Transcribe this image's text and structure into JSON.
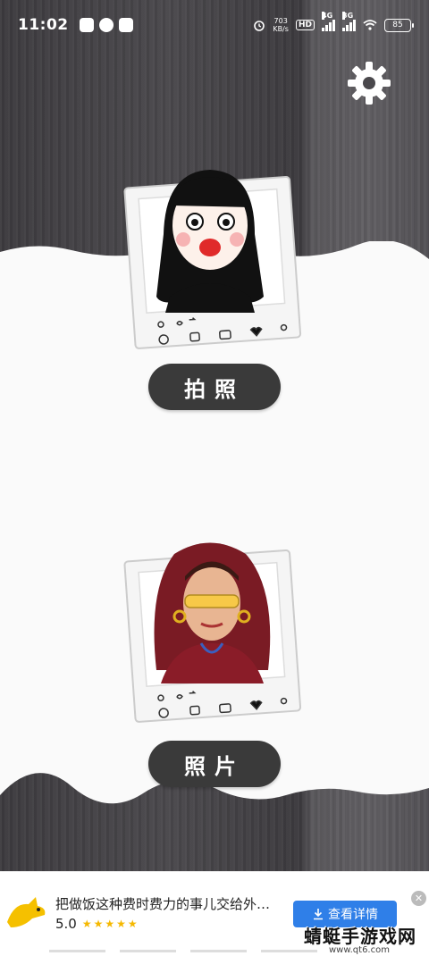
{
  "status_bar": {
    "time": "11:02",
    "speed_value": "703",
    "speed_unit": "KB/s",
    "hd_label": "HD",
    "network_1": "4G",
    "network_2": "3G",
    "battery": "85"
  },
  "main": {
    "take_photo_label": "拍照",
    "photo_label": "照片"
  },
  "ad": {
    "title": "把做饭这种费时费力的事儿交给外…",
    "rating": "5.0",
    "stars": "★★★★★",
    "cta_label": "查看详情",
    "close_symbol": "✕"
  },
  "watermark": {
    "text": "蜻蜓手游戏网",
    "url": "www.qt6.com"
  },
  "colors": {
    "background_dark": "#3d3b3f",
    "button_dark": "#3a3a3a",
    "ad_button": "#2f7fe8",
    "star": "#f5b800"
  }
}
